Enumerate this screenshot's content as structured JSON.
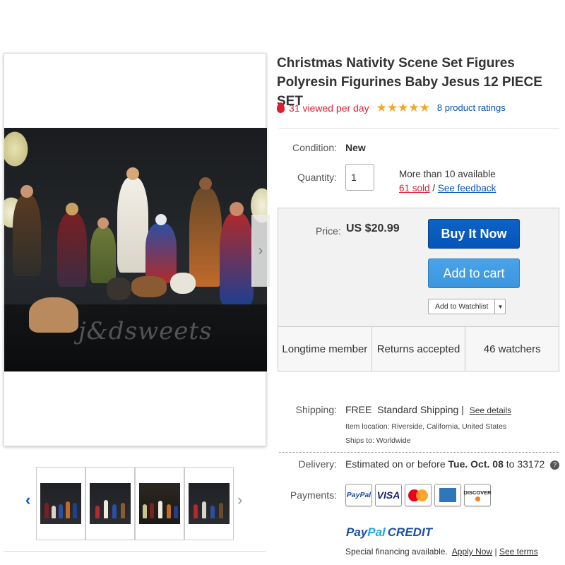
{
  "listing": {
    "title": "Christmas Nativity Scene Set Figures Polyresin Figurines Baby Jesus 12 PIECE SET",
    "trend_text": "31 viewed per day",
    "rating_stars": 5,
    "ratings_link": "8 product ratings"
  },
  "gallery": {
    "watermark": "j&dsweets",
    "next_arrow": "›",
    "thumb_prev": "‹",
    "thumb_next": "›",
    "thumbnails": 4
  },
  "details": {
    "condition_label": "Condition:",
    "condition_value": "New",
    "quantity_label": "Quantity:",
    "quantity_value": "1",
    "availability": "More than 10 available",
    "sold_link": "61 sold",
    "separator": "/",
    "feedback_link": "See feedback"
  },
  "buy_box": {
    "price_label": "Price:",
    "price_value": "US $20.99",
    "buy_now": "Buy It Now",
    "add_to_cart": "Add to cart",
    "watchlist": "Add to Watchlist",
    "highlights": [
      "Longtime member",
      "Returns accepted",
      "46 watchers"
    ]
  },
  "shipping": {
    "label": "Shipping:",
    "free": "FREE",
    "method": "Standard Shipping |",
    "details_link": "See details",
    "item_location": "Item location:  Riverside, California, United States",
    "ships_to": "Ships to:  Worldwide"
  },
  "delivery": {
    "label": "Delivery:",
    "prefix": "Estimated on or before",
    "date": "Tue. Oct. 08",
    "suffix": "to 33172",
    "help": "?"
  },
  "payments": {
    "label": "Payments:",
    "cards": {
      "paypal": "PayPal",
      "visa": "VISA",
      "mastercard": "mastercard",
      "amex": "AMERICAN EXPRESS",
      "discover": "DISCOVER"
    },
    "paypal_credit": {
      "p1": "Pay",
      "p2": "Pal",
      "p3": "CREDIT"
    },
    "financing_text": "Special financing available.",
    "apply_link": "Apply Now",
    "terms_sep": "|",
    "terms_link": "See terms"
  },
  "colors": {
    "link_blue": "#0654ba",
    "alert_red": "#dd1e31",
    "star_gold": "#f5a623",
    "buy_now_bg": "#0654ba",
    "add_cart_bg": "#3b96df"
  }
}
